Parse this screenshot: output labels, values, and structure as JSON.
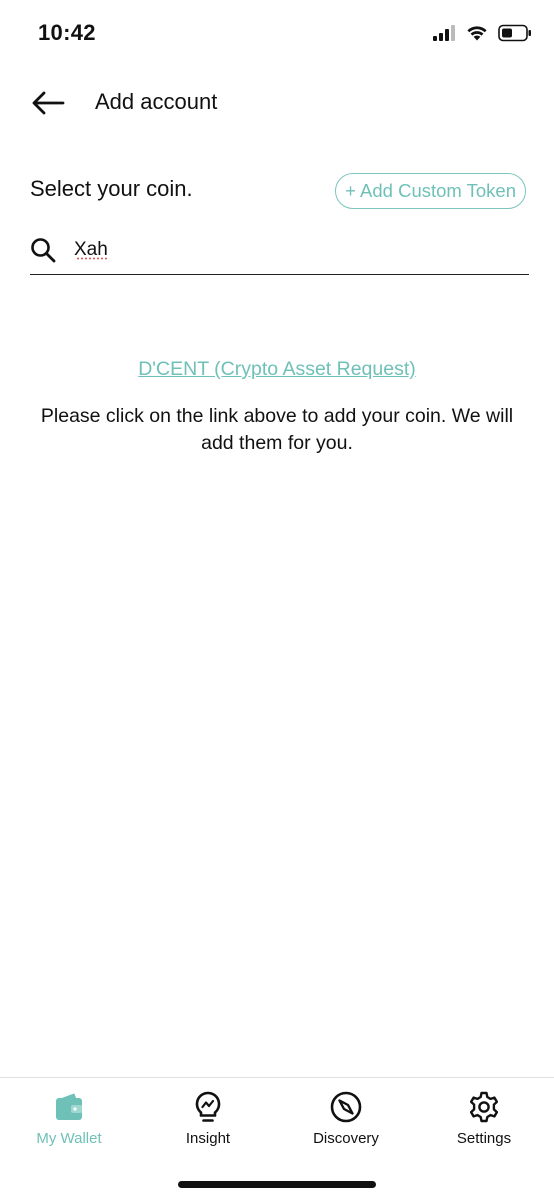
{
  "status_bar": {
    "time": "10:42"
  },
  "header": {
    "title": "Add account"
  },
  "select": {
    "label": "Select your coin.",
    "custom_token_label": "+ Add Custom Token"
  },
  "search": {
    "value": "Xah"
  },
  "message": {
    "link_text": "D'CENT (Crypto Asset Request)",
    "info_text": "Please click on the link above to add your coin. We will add them for you."
  },
  "tabs": [
    {
      "label": "My Wallet",
      "icon": "wallet-icon",
      "active": true
    },
    {
      "label": "Insight",
      "icon": "lightbulb-icon",
      "active": false
    },
    {
      "label": "Discovery",
      "icon": "compass-icon",
      "active": false
    },
    {
      "label": "Settings",
      "icon": "gear-icon",
      "active": false
    }
  ],
  "colors": {
    "accent": "#6fc1b8",
    "text": "#111111",
    "background": "#ffffff"
  }
}
